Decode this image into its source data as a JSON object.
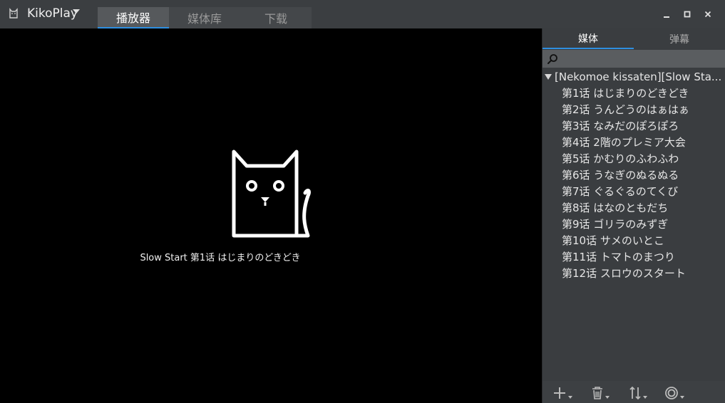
{
  "app": {
    "title": "KikoPlay"
  },
  "main_tabs": [
    {
      "label": "播放器",
      "active": true
    },
    {
      "label": "媒体库",
      "active": false
    },
    {
      "label": "下载",
      "active": false
    }
  ],
  "player": {
    "now_playing": "Slow Start 第1话 はじまりのどきどき"
  },
  "panel": {
    "tabs": [
      {
        "label": "媒体",
        "active": true
      },
      {
        "label": "弹幕",
        "active": false
      }
    ],
    "search": {
      "value": "",
      "placeholder": ""
    },
    "tree": {
      "root_label": "[Nekomoe kissaten][Slow Sta...",
      "episodes": [
        "第1话 はじまりのどきどき",
        "第2话 うんどうのはぁはぁ",
        "第3话 なみだのぽろぽろ",
        "第4话 2階のプレミア大会",
        "第5话 かむりのふわふわ",
        "第6话 うなぎのぬるぬる",
        "第7话 ぐるぐるのてくび",
        "第8话 はなのともだち",
        "第9话 ゴリラのみずぎ",
        "第10话 サメのいとこ",
        "第11话 トマトのまつり",
        "第12话 スロウのスタート"
      ]
    },
    "toolbar": [
      "plus-icon",
      "trash-icon",
      "sort-icon",
      "target-icon"
    ]
  },
  "colors": {
    "accent": "#2e8fe0",
    "titlebar_bg": "#3b3e41",
    "player_bg": "#000000",
    "panel_bg": "#3a3d40"
  }
}
